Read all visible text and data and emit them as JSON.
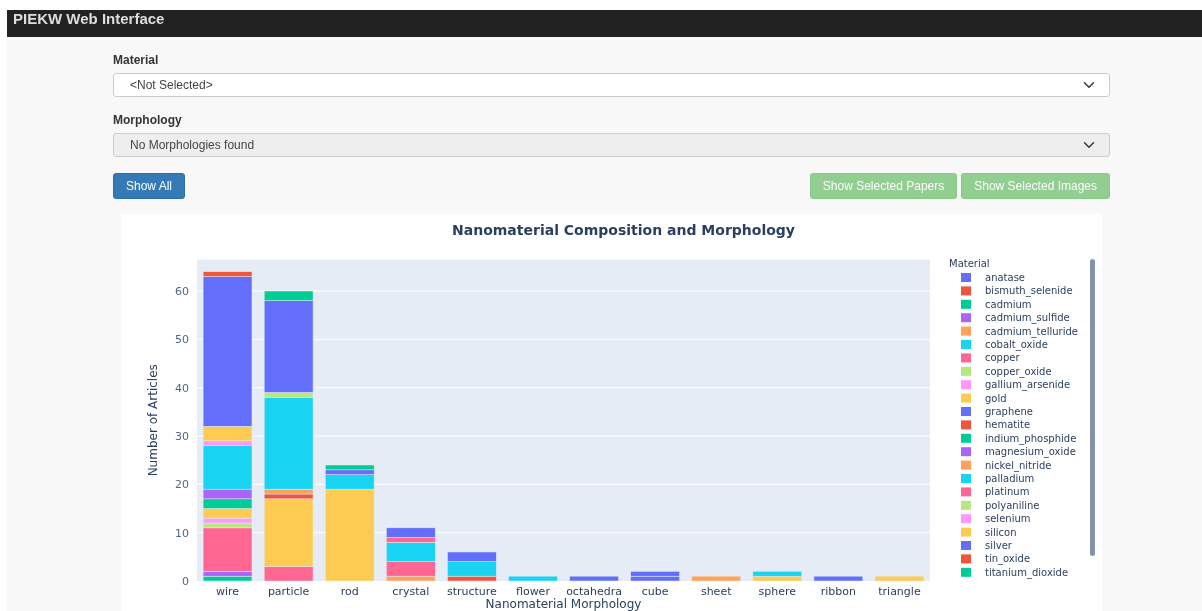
{
  "navbar": {
    "title": "PIEKW Web Interface"
  },
  "material": {
    "label": "Material",
    "value": "<Not Selected>",
    "disabled": false
  },
  "morphology": {
    "label": "Morphology",
    "value": "No Morphologies found",
    "disabled": true
  },
  "buttons": [
    {
      "label": "Show All",
      "disabled": false
    },
    {
      "label": "Show Selected Papers",
      "disabled": true
    },
    {
      "label": "Show Selected Images",
      "disabled": true
    }
  ],
  "chart": {
    "chart_data": {
      "type": "bar",
      "stacked": true,
      "title": "Nanomaterial Composition and Morphology",
      "xlabel": "Nanomaterial Morphology",
      "ylabel": "Number of Articles",
      "legend_title": "Material",
      "categories": [
        "wire",
        "particle",
        "rod",
        "crystal",
        "structure",
        "flower",
        "octahedra",
        "cube",
        "sheet",
        "sphere",
        "ribbon",
        "triangle"
      ],
      "ylim": [
        0,
        66.5
      ],
      "grid": true,
      "legend": true,
      "yticks": [
        0,
        10,
        20,
        30,
        40,
        50,
        60
      ],
      "series": [
        {
          "name": "anatase",
          "color": "#636efa",
          "values": [
            0,
            0,
            0,
            0,
            0,
            0,
            0,
            1,
            0,
            0,
            0,
            0
          ]
        },
        {
          "name": "bismuth_selenide",
          "color": "#ef553b",
          "values": [
            0,
            0,
            0,
            0,
            1,
            0,
            0,
            0,
            0,
            0,
            0,
            0
          ]
        },
        {
          "name": "cadmium",
          "color": "#00cc96",
          "values": [
            1,
            0,
            0,
            0,
            0,
            0,
            0,
            0,
            0,
            0,
            0,
            0
          ]
        },
        {
          "name": "cadmium_sulfide",
          "color": "#ab63fa",
          "values": [
            1,
            0,
            0,
            0,
            0,
            0,
            0,
            0,
            0,
            0,
            0,
            0
          ]
        },
        {
          "name": "cadmium_telluride",
          "color": "#ffa15a",
          "values": [
            0,
            0,
            0,
            1,
            0,
            0,
            0,
            0,
            0,
            0,
            0,
            0
          ]
        },
        {
          "name": "cobalt_oxide",
          "color": "#19d3f3",
          "values": [
            0,
            0,
            0,
            0,
            3,
            0,
            0,
            0,
            0,
            0,
            0,
            0
          ]
        },
        {
          "name": "copper",
          "color": "#ff6692",
          "values": [
            9,
            3,
            0,
            3,
            0,
            0,
            0,
            0,
            0,
            0,
            0,
            0
          ]
        },
        {
          "name": "copper_oxide",
          "color": "#b6e880",
          "values": [
            1,
            0,
            0,
            0,
            0,
            0,
            0,
            0,
            0,
            0,
            0,
            0
          ]
        },
        {
          "name": "gallium_arsenide",
          "color": "#ff97ff",
          "values": [
            1,
            0,
            0,
            0,
            0,
            0,
            0,
            0,
            0,
            0,
            0,
            0
          ]
        },
        {
          "name": "gold",
          "color": "#fecb52",
          "values": [
            2,
            14,
            19,
            0,
            0,
            0,
            0,
            0,
            0,
            1,
            0,
            0
          ]
        },
        {
          "name": "graphene",
          "color": "#636efa",
          "values": [
            0,
            0,
            0,
            0,
            0,
            0,
            0,
            0,
            0,
            0,
            0,
            0
          ]
        },
        {
          "name": "hematite",
          "color": "#ef553b",
          "values": [
            0,
            1,
            0,
            0,
            0,
            0,
            0,
            0,
            0,
            0,
            0,
            0
          ]
        },
        {
          "name": "indium_phosphide",
          "color": "#00cc96",
          "values": [
            2,
            0,
            0,
            0,
            0,
            0,
            0,
            0,
            0,
            0,
            0,
            0
          ]
        },
        {
          "name": "magnesium_oxide",
          "color": "#ab63fa",
          "values": [
            2,
            0,
            0,
            0,
            0,
            0,
            0,
            0,
            0,
            0,
            0,
            0
          ]
        },
        {
          "name": "nickel_nitride",
          "color": "#ffa15a",
          "values": [
            0,
            1,
            0,
            0,
            0,
            0,
            0,
            0,
            1,
            0,
            0,
            0
          ]
        },
        {
          "name": "palladium",
          "color": "#19d3f3",
          "values": [
            9,
            19,
            3,
            4,
            0,
            1,
            0,
            0,
            0,
            1,
            0,
            0
          ]
        },
        {
          "name": "platinum",
          "color": "#ff6692",
          "values": [
            0,
            0,
            0,
            1,
            0,
            0,
            0,
            0,
            0,
            0,
            0,
            0
          ]
        },
        {
          "name": "polyaniline",
          "color": "#b6e880",
          "values": [
            0,
            1,
            0,
            0,
            0,
            0,
            0,
            0,
            0,
            0,
            0,
            0
          ]
        },
        {
          "name": "selenium",
          "color": "#ff97ff",
          "values": [
            1,
            0,
            0,
            0,
            0,
            0,
            0,
            0,
            0,
            0,
            0,
            0
          ]
        },
        {
          "name": "silicon",
          "color": "#fecb52",
          "values": [
            3,
            0,
            0,
            0,
            0,
            0,
            0,
            0,
            0,
            0,
            0,
            1
          ]
        },
        {
          "name": "silver",
          "color": "#636efa",
          "values": [
            31,
            19,
            1,
            2,
            2,
            0,
            1,
            1,
            0,
            0,
            1,
            0
          ]
        },
        {
          "name": "tin_oxide",
          "color": "#ef553b",
          "values": [
            1,
            0,
            0,
            0,
            0,
            0,
            0,
            0,
            0,
            0,
            0,
            0
          ]
        },
        {
          "name": "titanium_dioxide",
          "color": "#00cc96",
          "values": [
            0,
            2,
            1,
            0,
            0,
            0,
            0,
            0,
            0,
            0,
            0,
            0
          ]
        }
      ]
    }
  }
}
